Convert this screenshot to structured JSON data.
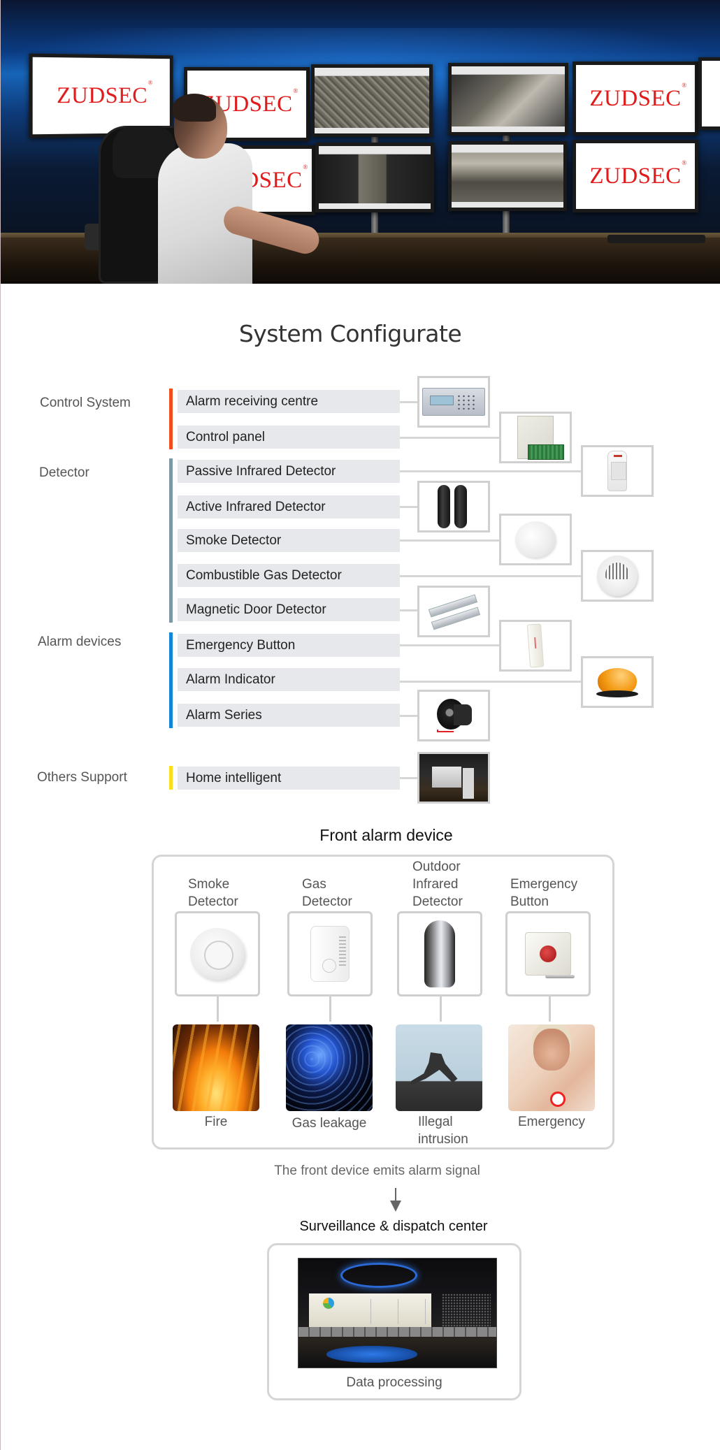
{
  "hero": {
    "brand_text": "ZUDSEC",
    "brand_mark": "®",
    "brand_color": "#e01b1b",
    "scene": "security operator monitoring video wall"
  },
  "system_config": {
    "title": "System Configurate",
    "categories": [
      {
        "label": "Control System",
        "color": "#f04e1c",
        "items": [
          {
            "label": "Alarm receiving centre",
            "product_icon": "rack-receiver-icon"
          },
          {
            "label": "Control panel",
            "product_icon": "control-panel-icon"
          }
        ]
      },
      {
        "label": "Detector",
        "color": "#7c98a6",
        "items": [
          {
            "label": "Passive Infrared Detector",
            "product_icon": "pir-sensor-icon"
          },
          {
            "label": "Active Infrared Detector",
            "product_icon": "beam-sensor-icon"
          },
          {
            "label": "Smoke Detector",
            "product_icon": "smoke-detector-icon"
          },
          {
            "label": "Combustible Gas Detector",
            "product_icon": "gas-detector-icon"
          },
          {
            "label": "Magnetic Door Detector",
            "product_icon": "door-contact-icon"
          }
        ]
      },
      {
        "label": "Alarm devices",
        "color": "#0f86d8",
        "items": [
          {
            "label": "Emergency Button",
            "product_icon": "emergency-button-icon"
          },
          {
            "label": "Alarm Indicator",
            "product_icon": "strobe-beacon-icon"
          },
          {
            "label": "Alarm Series",
            "product_icon": "siren-icon"
          }
        ]
      },
      {
        "label": "Others Support",
        "color": "#f5e21a",
        "items": [
          {
            "label": "Home intelligent",
            "product_icon": "smart-home-icon"
          }
        ]
      }
    ]
  },
  "front_alarm": {
    "title": "Front alarm device",
    "devices": [
      {
        "label_lines": [
          "Smoke",
          "Detector"
        ],
        "scene": "Fire",
        "scene_lines": [
          "Fire"
        ]
      },
      {
        "label_lines": [
          "Gas",
          "Detector"
        ],
        "scene": "Gas leakage",
        "scene_lines": [
          "Gas leakage"
        ]
      },
      {
        "label_lines": [
          "Outdoor",
          "Infrared",
          "Detector"
        ],
        "scene": "Illegal intrusion",
        "scene_lines": [
          "Illegal",
          "intrusion"
        ]
      },
      {
        "label_lines": [
          "Emergency",
          "Button"
        ],
        "scene": "Emergency",
        "scene_lines": [
          "Emergency"
        ]
      }
    ]
  },
  "flow": {
    "emit_text": "The front device emits alarm signal",
    "arrow_icon": "arrow-down-icon"
  },
  "dispatch": {
    "title": "Surveillance & dispatch center",
    "caption": "Data processing"
  }
}
